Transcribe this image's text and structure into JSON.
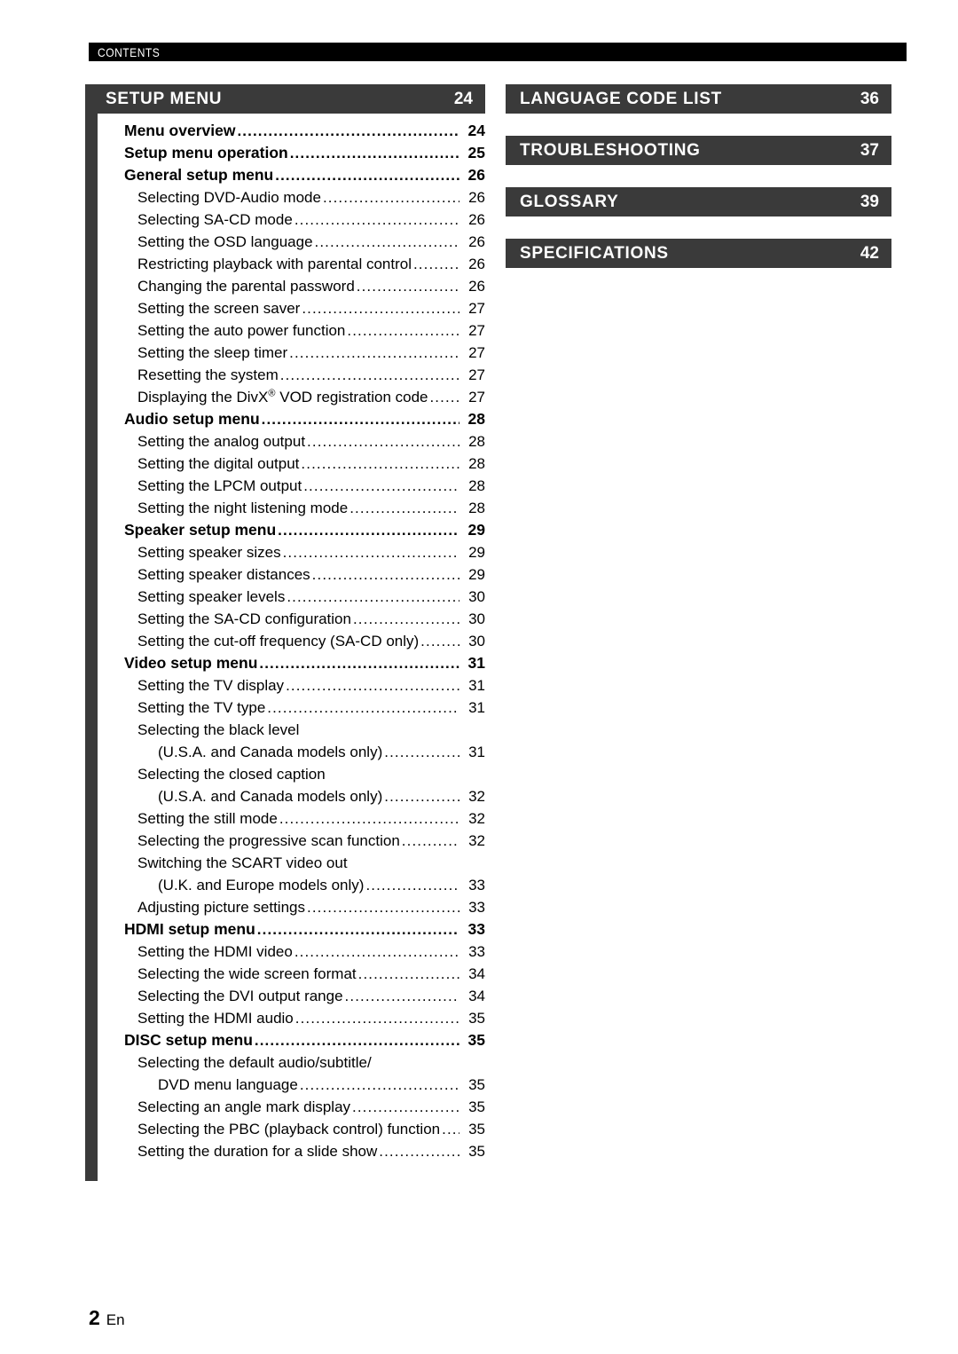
{
  "running_head": "CONTENTS",
  "footer": {
    "page_number": "2",
    "language_code": "En"
  },
  "left_column": {
    "section": {
      "title": "SETUP MENU",
      "page": "24"
    },
    "entries": [
      {
        "level": 1,
        "text": "Menu overview",
        "page": "24",
        "leader": true
      },
      {
        "level": 1,
        "text": "Setup menu operation",
        "page": "25",
        "leader": true
      },
      {
        "level": 1,
        "text": "General setup menu ",
        "page": "26",
        "leader": true
      },
      {
        "level": 2,
        "text": "Selecting DVD-Audio mode",
        "page": "26",
        "leader": true
      },
      {
        "level": 2,
        "text": "Selecting SA-CD mode",
        "page": "26",
        "leader": true
      },
      {
        "level": 2,
        "text": "Setting the OSD language",
        "page": "26",
        "leader": true
      },
      {
        "level": 2,
        "text": "Restricting playback with parental control ",
        "page": "26",
        "leader": true
      },
      {
        "level": 2,
        "text": "Changing the parental password",
        "page": "26",
        "leader": true
      },
      {
        "level": 2,
        "text": "Setting the screen saver",
        "page": "27",
        "leader": true
      },
      {
        "level": 2,
        "text": "Setting the auto power function ",
        "page": "27",
        "leader": true
      },
      {
        "level": 2,
        "text": "Setting the sleep timer",
        "page": "27",
        "leader": true
      },
      {
        "level": 2,
        "text": "Resetting the system ",
        "page": "27",
        "leader": true
      },
      {
        "level": 2,
        "text": "Displaying the DivX® VOD registration code",
        "page": "27",
        "leader": true
      },
      {
        "level": 1,
        "text": "Audio setup menu ",
        "page": "28",
        "leader": true
      },
      {
        "level": 2,
        "text": "Setting the analog output ",
        "page": "28",
        "leader": true
      },
      {
        "level": 2,
        "text": "Setting the digital output",
        "page": "28",
        "leader": true
      },
      {
        "level": 2,
        "text": "Setting the LPCM output ",
        "page": "28",
        "leader": true
      },
      {
        "level": 2,
        "text": "Setting the night listening mode ",
        "page": "28",
        "leader": true
      },
      {
        "level": 1,
        "text": "Speaker setup menu",
        "page": "29",
        "leader": true
      },
      {
        "level": 2,
        "text": "Setting speaker sizes",
        "page": "29",
        "leader": true
      },
      {
        "level": 2,
        "text": "Setting speaker distances ",
        "page": "29",
        "leader": true
      },
      {
        "level": 2,
        "text": "Setting speaker levels",
        "page": "30",
        "leader": true
      },
      {
        "level": 2,
        "text": "Setting the SA-CD configuration",
        "page": "30",
        "leader": true
      },
      {
        "level": 2,
        "text": "Setting the cut-off frequency (SA-CD only)",
        "page": "30",
        "leader": true
      },
      {
        "level": 1,
        "text": "Video setup menu",
        "page": "31",
        "leader": true
      },
      {
        "level": 2,
        "text": "Setting the TV display ",
        "page": "31",
        "leader": true
      },
      {
        "level": 2,
        "text": "Setting the TV type",
        "page": "31",
        "leader": true
      },
      {
        "level": 2,
        "text": "Selecting the black level",
        "page": "",
        "leader": false
      },
      {
        "level": 3,
        "text": "(U.S.A. and Canada models only) ",
        "page": "31",
        "leader": true
      },
      {
        "level": 2,
        "text": "Selecting the closed caption",
        "page": "",
        "leader": false
      },
      {
        "level": 3,
        "text": "(U.S.A. and Canada models only) ",
        "page": "32",
        "leader": true
      },
      {
        "level": 2,
        "text": "Setting the still mode ",
        "page": "32",
        "leader": true
      },
      {
        "level": 2,
        "text": "Selecting the progressive scan function",
        "page": "32",
        "leader": true
      },
      {
        "level": 2,
        "text": "Switching the SCART video out",
        "page": "",
        "leader": false
      },
      {
        "level": 3,
        "text": "(U.K. and Europe models only) ",
        "page": "33",
        "leader": true
      },
      {
        "level": 2,
        "text": "Adjusting picture settings ",
        "page": "33",
        "leader": true
      },
      {
        "level": 1,
        "text": "HDMI setup menu ",
        "page": "33",
        "leader": true
      },
      {
        "level": 2,
        "text": "Setting the HDMI video",
        "page": "33",
        "leader": true
      },
      {
        "level": 2,
        "text": "Selecting the wide screen format ",
        "page": "34",
        "leader": true
      },
      {
        "level": 2,
        "text": "Selecting the DVI output range ",
        "page": "34",
        "leader": true
      },
      {
        "level": 2,
        "text": "Setting the HDMI audio",
        "page": "35",
        "leader": true
      },
      {
        "level": 1,
        "text": "DISC setup menu ",
        "page": "35",
        "leader": true
      },
      {
        "level": 2,
        "text": "Selecting the default audio/subtitle/",
        "page": "",
        "leader": false
      },
      {
        "level": 3,
        "text": "DVD menu language ",
        "page": "35",
        "leader": true
      },
      {
        "level": 2,
        "text": "Selecting an angle mark display ",
        "page": "35",
        "leader": true
      },
      {
        "level": 2,
        "text": "Selecting the PBC (playback control) function",
        "page": "35",
        "leader": true
      },
      {
        "level": 2,
        "text": "Setting the duration for a slide show ",
        "page": "35",
        "leader": true
      }
    ]
  },
  "right_column": {
    "sections": [
      {
        "title": "LANGUAGE CODE LIST",
        "page": "36"
      },
      {
        "title": "TROUBLESHOOTING",
        "page": "37"
      },
      {
        "title": "GLOSSARY",
        "page": "39"
      },
      {
        "title": "SPECIFICATIONS",
        "page": "42"
      }
    ]
  }
}
